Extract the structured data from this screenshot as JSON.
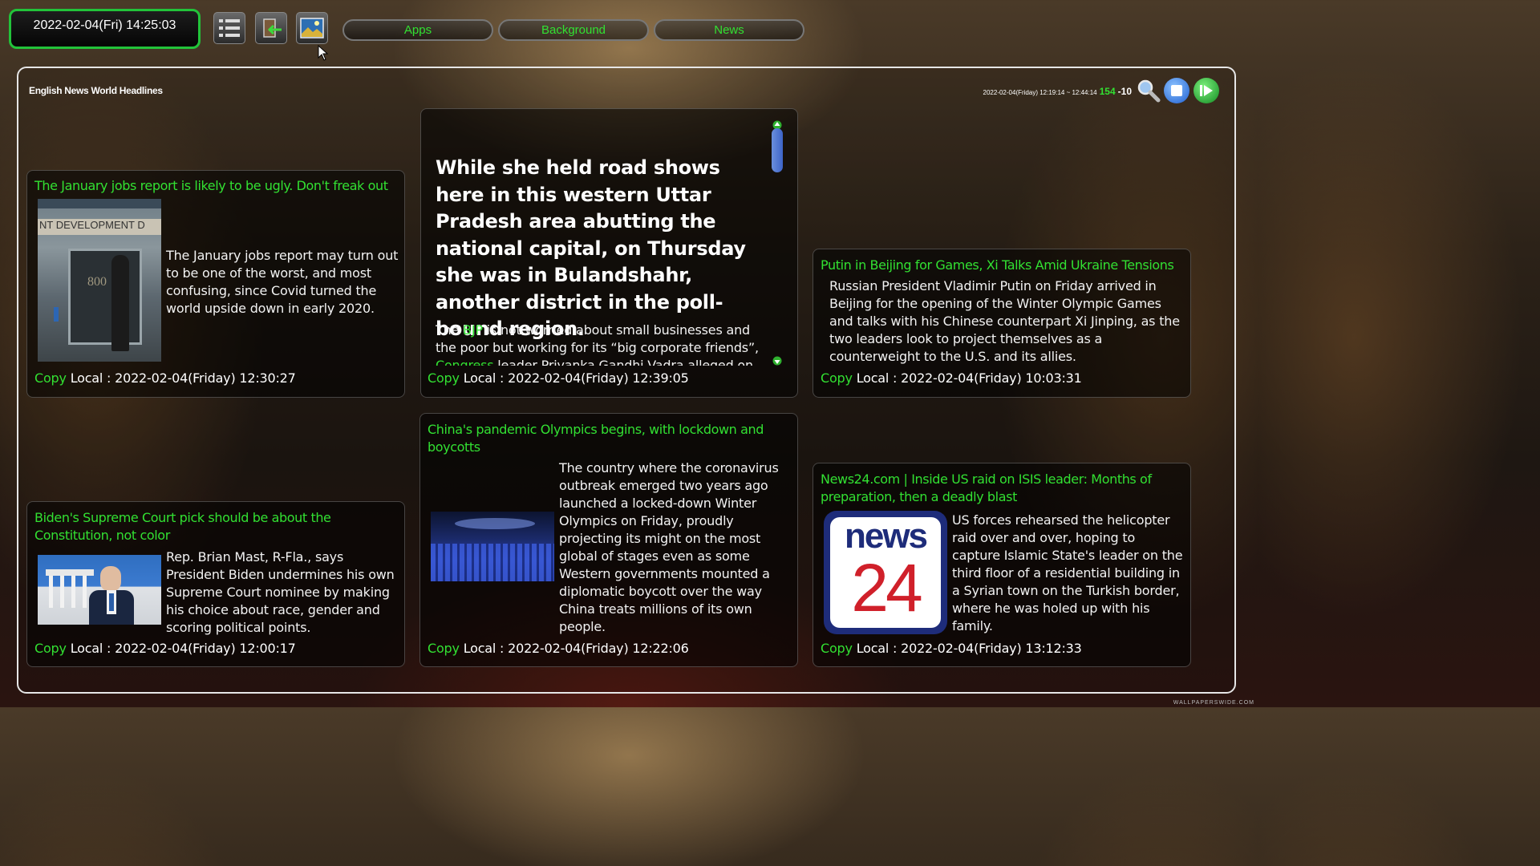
{
  "topbar": {
    "clock": "2022-02-04(Fri) 14:25:03",
    "icons": [
      "list-icon",
      "back-icon",
      "picture-icon"
    ],
    "tabs": [
      "Apps",
      "Background",
      "News"
    ]
  },
  "panel": {
    "title": "English News World Headlines",
    "status_range": "2022-02-04(Friday) 12:19:14 ~ 12:44:14",
    "count": "154",
    "offset": "-10"
  },
  "cards": [
    {
      "headline": "The January jobs report is likely to be ugly. Don't freak out",
      "summary": "The January jobs report may turn out to be one of the worst, and most confusing, since Covid turned the world upside down in early 2020.",
      "copy": "Copy",
      "local": "Local : 2022-02-04(Friday) 12:30:27",
      "thumb_text": "NT DEVELOPMENT D",
      "thumb_num": "800"
    },
    {
      "big_text": "While she held road shows here in this western Uttar Pradesh area abutting the national capital, on Thursday she was in Bulandshahr, another district in the poll-bound region.",
      "para_pre": "The ",
      "para_link": "BJP",
      "para_mid": " is not worried about small businesses and the poor but working for its “big corporate friends”, ",
      "para_link2": "Congress",
      "para_post": " leader Priyanka Gandhi Vadra alleged on",
      "copy": "Copy",
      "local": "Local : 2022-02-04(Friday) 12:39:05"
    },
    {
      "headline": "Putin in Beijing for Games, Xi Talks Amid Ukraine Tensions",
      "summary": "Russian President Vladimir Putin on Friday arrived in Beijing for the opening of the Winter Olympic Games and talks with his Chinese counterpart Xi Jinping, as the two leaders look to project themselves as a counterweight to the U.S. and its allies.",
      "copy": "Copy",
      "local": "Local : 2022-02-04(Friday) 10:03:31"
    },
    {
      "headline": "Biden's Supreme Court pick should be about the Constitution, not color",
      "summary": "Rep. Brian Mast, R-Fla., says President Biden undermines his own Supreme Court nominee by making his choice about race, gender and scoring political points.",
      "copy": "Copy",
      "local": "Local : 2022-02-04(Friday) 12:00:17"
    },
    {
      "headline": "China's pandemic Olympics begins, with lockdown and boycotts",
      "summary": "The country where the coronavirus outbreak emerged two years ago launched a locked-down Winter Olympics on Friday, proudly projecting its might on the most global of stages even as some Western governments mounted a diplomatic boycott over the way China treats millions of its own people.",
      "copy": "Copy",
      "local": "Local : 2022-02-04(Friday) 12:22:06"
    },
    {
      "headline": "News24.com | Inside US raid on ISIS leader: Months of preparation, then a deadly blast",
      "summary": "US forces rehearsed the helicopter raid over and over, hoping to capture Islamic State's leader on the third floor of a residential building in a Syrian town on the Turkish border, where he was holed up with his family.",
      "copy": "Copy",
      "local": "Local : 2022-02-04(Friday) 13:12:33",
      "logo_word": "news",
      "logo_num": "24"
    }
  ],
  "watermark": "WALLPAPERSWIDE.COM",
  "colors": {
    "accent": "#32e032",
    "text": "#f2f2f2",
    "logo_red": "#d0202a",
    "logo_navy": "#1e2c7a"
  }
}
